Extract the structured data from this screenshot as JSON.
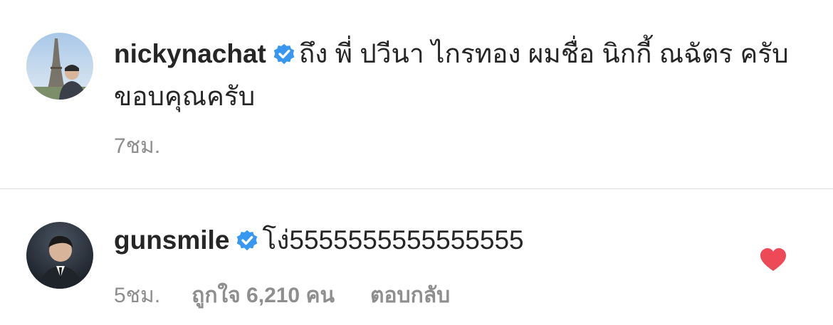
{
  "comments": [
    {
      "username": "nickynachat",
      "verified": true,
      "text": "ถึง พี่ ปวีนา ไกรทอง ผมชื่อ นิกกี้ ณฉัตร ครับ ขอบคุณครับ",
      "time": "7ชม.",
      "avatar": "avatar-eiffel-tower"
    },
    {
      "username": "gunsmile",
      "verified": true,
      "text": "โง่5555555555555555",
      "time": "5ชม.",
      "likes": "ถูกใจ 6,210 คน",
      "reply": "ตอบกลับ",
      "liked": true,
      "avatar": "avatar-portrait"
    }
  ],
  "colors": {
    "verified_badge": "#3897f0",
    "heart": "#ed4956",
    "meta_text": "#8e8e8e",
    "divider": "#dbdbdb"
  }
}
